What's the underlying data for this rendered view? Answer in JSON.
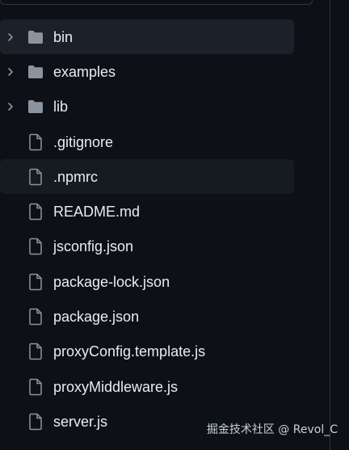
{
  "file_tree": {
    "items": [
      {
        "name": "bin",
        "type": "folder",
        "state": "active"
      },
      {
        "name": "examples",
        "type": "folder",
        "state": "normal"
      },
      {
        "name": "lib",
        "type": "folder",
        "state": "normal"
      },
      {
        "name": ".gitignore",
        "type": "file",
        "state": "normal"
      },
      {
        "name": ".npmrc",
        "type": "file",
        "state": "hover"
      },
      {
        "name": "README.md",
        "type": "file",
        "state": "normal"
      },
      {
        "name": "jsconfig.json",
        "type": "file",
        "state": "normal"
      },
      {
        "name": "package-lock.json",
        "type": "file",
        "state": "normal"
      },
      {
        "name": "package.json",
        "type": "file",
        "state": "normal"
      },
      {
        "name": "proxyConfig.template.js",
        "type": "file",
        "state": "normal"
      },
      {
        "name": "proxyMiddleware.js",
        "type": "file",
        "state": "normal"
      },
      {
        "name": "server.js",
        "type": "file",
        "state": "normal"
      }
    ]
  },
  "icons": {
    "folder": "folder-icon",
    "file": "file-icon",
    "chevron": "chevron-right-icon"
  },
  "colors": {
    "background": "#0d1117",
    "text": "#e6edf3",
    "icon": "#8b949e",
    "active_row": "#1c2129",
    "border": "#30363d"
  },
  "watermark": "掘金技术社区 @ Revol_C"
}
